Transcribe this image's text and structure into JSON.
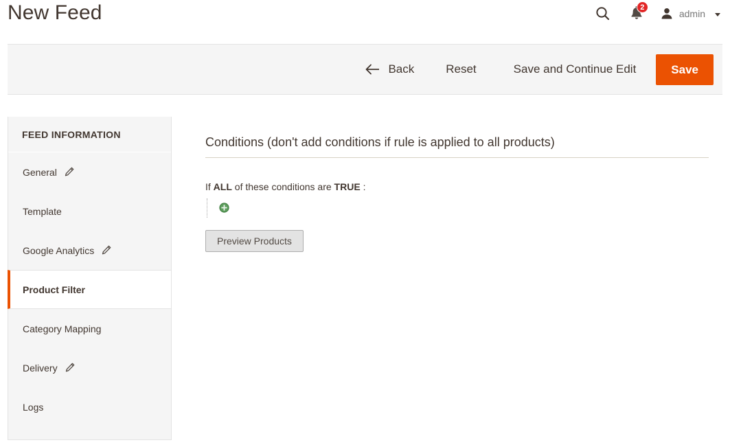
{
  "header": {
    "title": "New Feed",
    "search_icon": "search-icon",
    "notifications": {
      "icon": "bell-icon",
      "count": "2",
      "badge_color": "#e22626"
    },
    "user": {
      "avatar_icon": "user-avatar-icon",
      "name": "admin",
      "caret_icon": "chevron-down-icon"
    }
  },
  "toolbar": {
    "back_icon": "arrow-left-icon",
    "back_label": "Back",
    "reset_label": "Reset",
    "save_continue_label": "Save and Continue Edit",
    "save_label": "Save",
    "save_color": "#eb5202"
  },
  "sidebar": {
    "heading": "FEED INFORMATION",
    "items": [
      {
        "label": "General",
        "edit_icon": "pencil-icon",
        "has_edit": true,
        "active": false
      },
      {
        "label": "Template",
        "edit_icon": "",
        "has_edit": false,
        "active": false
      },
      {
        "label": "Google Analytics",
        "edit_icon": "pencil-icon",
        "has_edit": true,
        "active": false
      },
      {
        "label": "Product Filter",
        "edit_icon": "",
        "has_edit": false,
        "active": true
      },
      {
        "label": "Category Mapping",
        "edit_icon": "",
        "has_edit": false,
        "active": false
      },
      {
        "label": "Delivery",
        "edit_icon": "pencil-icon",
        "has_edit": true,
        "active": false
      },
      {
        "label": "Logs",
        "edit_icon": "",
        "has_edit": false,
        "active": false
      }
    ],
    "active_accent": "#eb5202"
  },
  "main": {
    "section_title": "Conditions (don't add conditions if rule is applied to all products)",
    "condition": {
      "prefix": "If",
      "aggregator": "ALL",
      "middle": "of these conditions are",
      "value": "TRUE",
      "suffix": ":",
      "add_icon": "add-circle-icon"
    },
    "preview_button_label": "Preview Products"
  }
}
